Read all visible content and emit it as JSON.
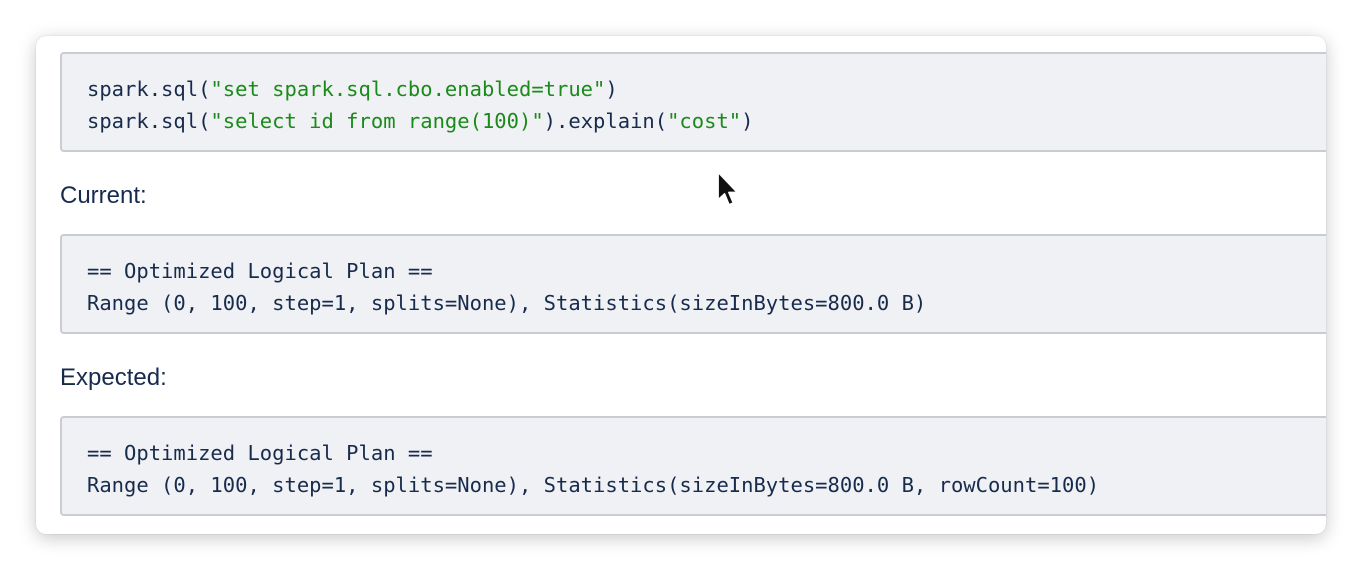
{
  "code_block": {
    "line1": {
      "prefix": "spark.sql(",
      "arg": "\"set spark.sql.cbo.enabled=true\"",
      "suffix": ")"
    },
    "line2": {
      "prefix": "spark.sql(",
      "arg": "\"select id from range(100)\"",
      "mid": ").explain(",
      "arg2": "\"cost\"",
      "suffix": ")"
    }
  },
  "current": {
    "label": "Current:",
    "line1": "== Optimized Logical Plan ==",
    "line2": "Range (0, 100, step=1, splits=None), Statistics(sizeInBytes=800.0 B)"
  },
  "expected": {
    "label": "Expected:",
    "line1": "== Optimized Logical Plan ==",
    "line2": "Range (0, 100, step=1, splits=None), Statistics(sizeInBytes=800.0 B, rowCount=100)"
  },
  "colors": {
    "text": "#172b4d",
    "string": "#1a8a1a",
    "code_bg": "#f0f1f4",
    "code_border": "#c9ccd3"
  },
  "icons": {
    "cursor": "mouse-pointer-icon"
  }
}
